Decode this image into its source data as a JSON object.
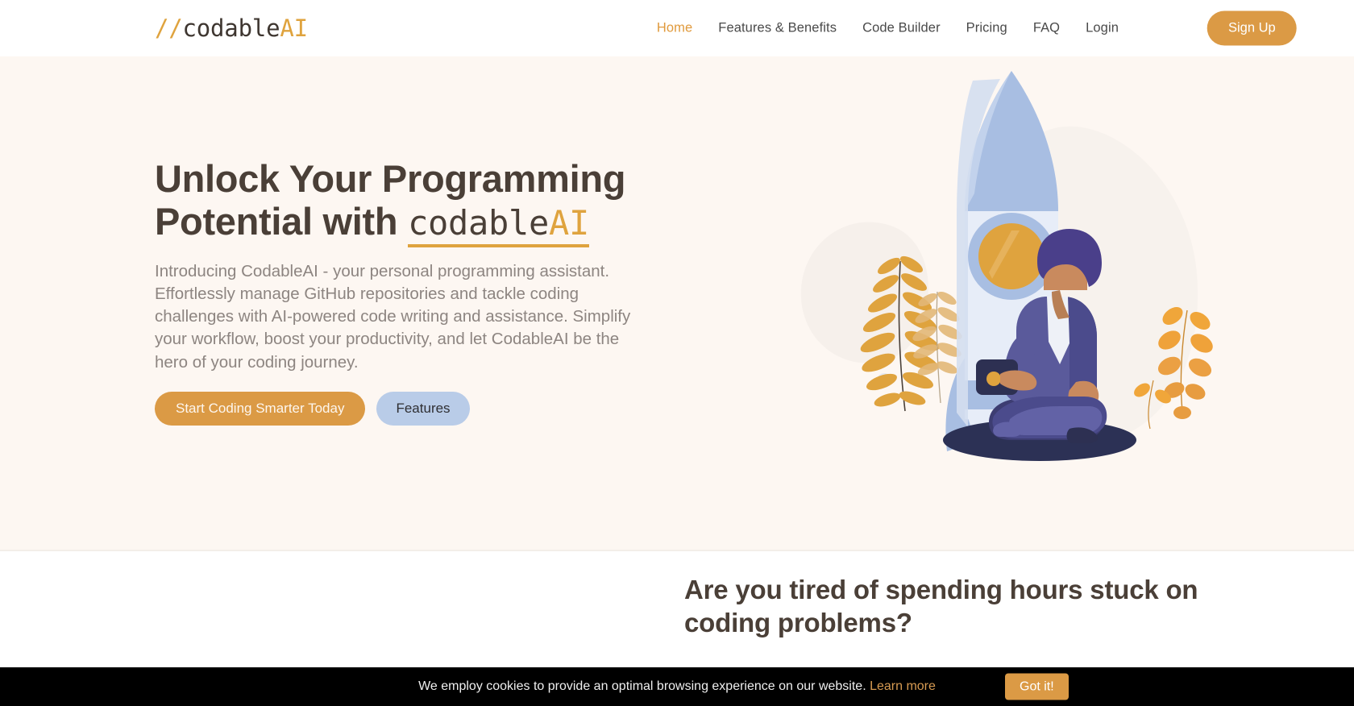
{
  "header": {
    "logo": {
      "slash": "//",
      "name": "codable",
      "ai": "AI"
    },
    "nav": [
      {
        "label": "Home",
        "active": true
      },
      {
        "label": "Features & Benefits",
        "active": false
      },
      {
        "label": "Code Builder",
        "active": false
      },
      {
        "label": "Pricing",
        "active": false
      },
      {
        "label": "FAQ",
        "active": false
      },
      {
        "label": "Login",
        "active": false
      }
    ],
    "signup_label": "Sign Up"
  },
  "hero": {
    "title_line1": "Unlock Your Programming",
    "title_line2_prefix": "Potential with ",
    "brand_dark": "codable",
    "brand_accent": "AI",
    "subtitle": "Introducing CodableAI - your personal programming assistant. Effortlessly manage GitHub repositories and tackle coding challenges with AI-powered code writing and assistance. Simplify your workflow, boost your productivity, and let CodableAI be the hero of your coding journey.",
    "primary_cta": "Start Coding Smarter Today",
    "secondary_cta": "Features",
    "illustration": "rocket-and-person-illustration"
  },
  "section2": {
    "heading": "Are you tired of spending hours stuck on coding problems?"
  },
  "cookie": {
    "message": "We employ cookies to provide an optimal browsing experience on our website. ",
    "link_label": "Learn more",
    "accept_label": "Got it!"
  },
  "colors": {
    "accent_orange": "#DB9A45",
    "logo_orange": "#DFA33E",
    "heading_brown": "#4A3F37",
    "body_gray": "#8D8581",
    "hero_bg": "#FDF7F2",
    "secondary_blue": "#B9CCE8",
    "cookie_bg": "#000000",
    "cookie_link": "#D79B52"
  }
}
